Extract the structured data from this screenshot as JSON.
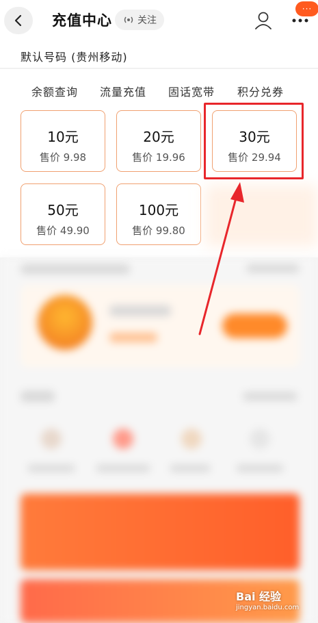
{
  "header": {
    "title": "充值中心",
    "follow_label": "关注",
    "badge": "···"
  },
  "account": {
    "default_number": "默认号码 (贵州移动)"
  },
  "tabs": [
    {
      "label": "余额查询"
    },
    {
      "label": "流量充值"
    },
    {
      "label": "固话宽带"
    },
    {
      "label": "积分兑券"
    }
  ],
  "recharge_options": [
    {
      "amount": "10元",
      "price": "售价 9.98"
    },
    {
      "amount": "20元",
      "price": "售价 19.96"
    },
    {
      "amount": "30元",
      "price": "售价 29.94"
    },
    {
      "amount": "50元",
      "price": "售价 49.90"
    },
    {
      "amount": "100元",
      "price": "售价 99.80"
    }
  ],
  "watermark": {
    "line1": "Bai 经验",
    "line2": "jingyan.baidu.com"
  },
  "colors": {
    "accent": "#ff5a1f",
    "card_border": "#f0a070",
    "highlight": "#e8262b"
  }
}
